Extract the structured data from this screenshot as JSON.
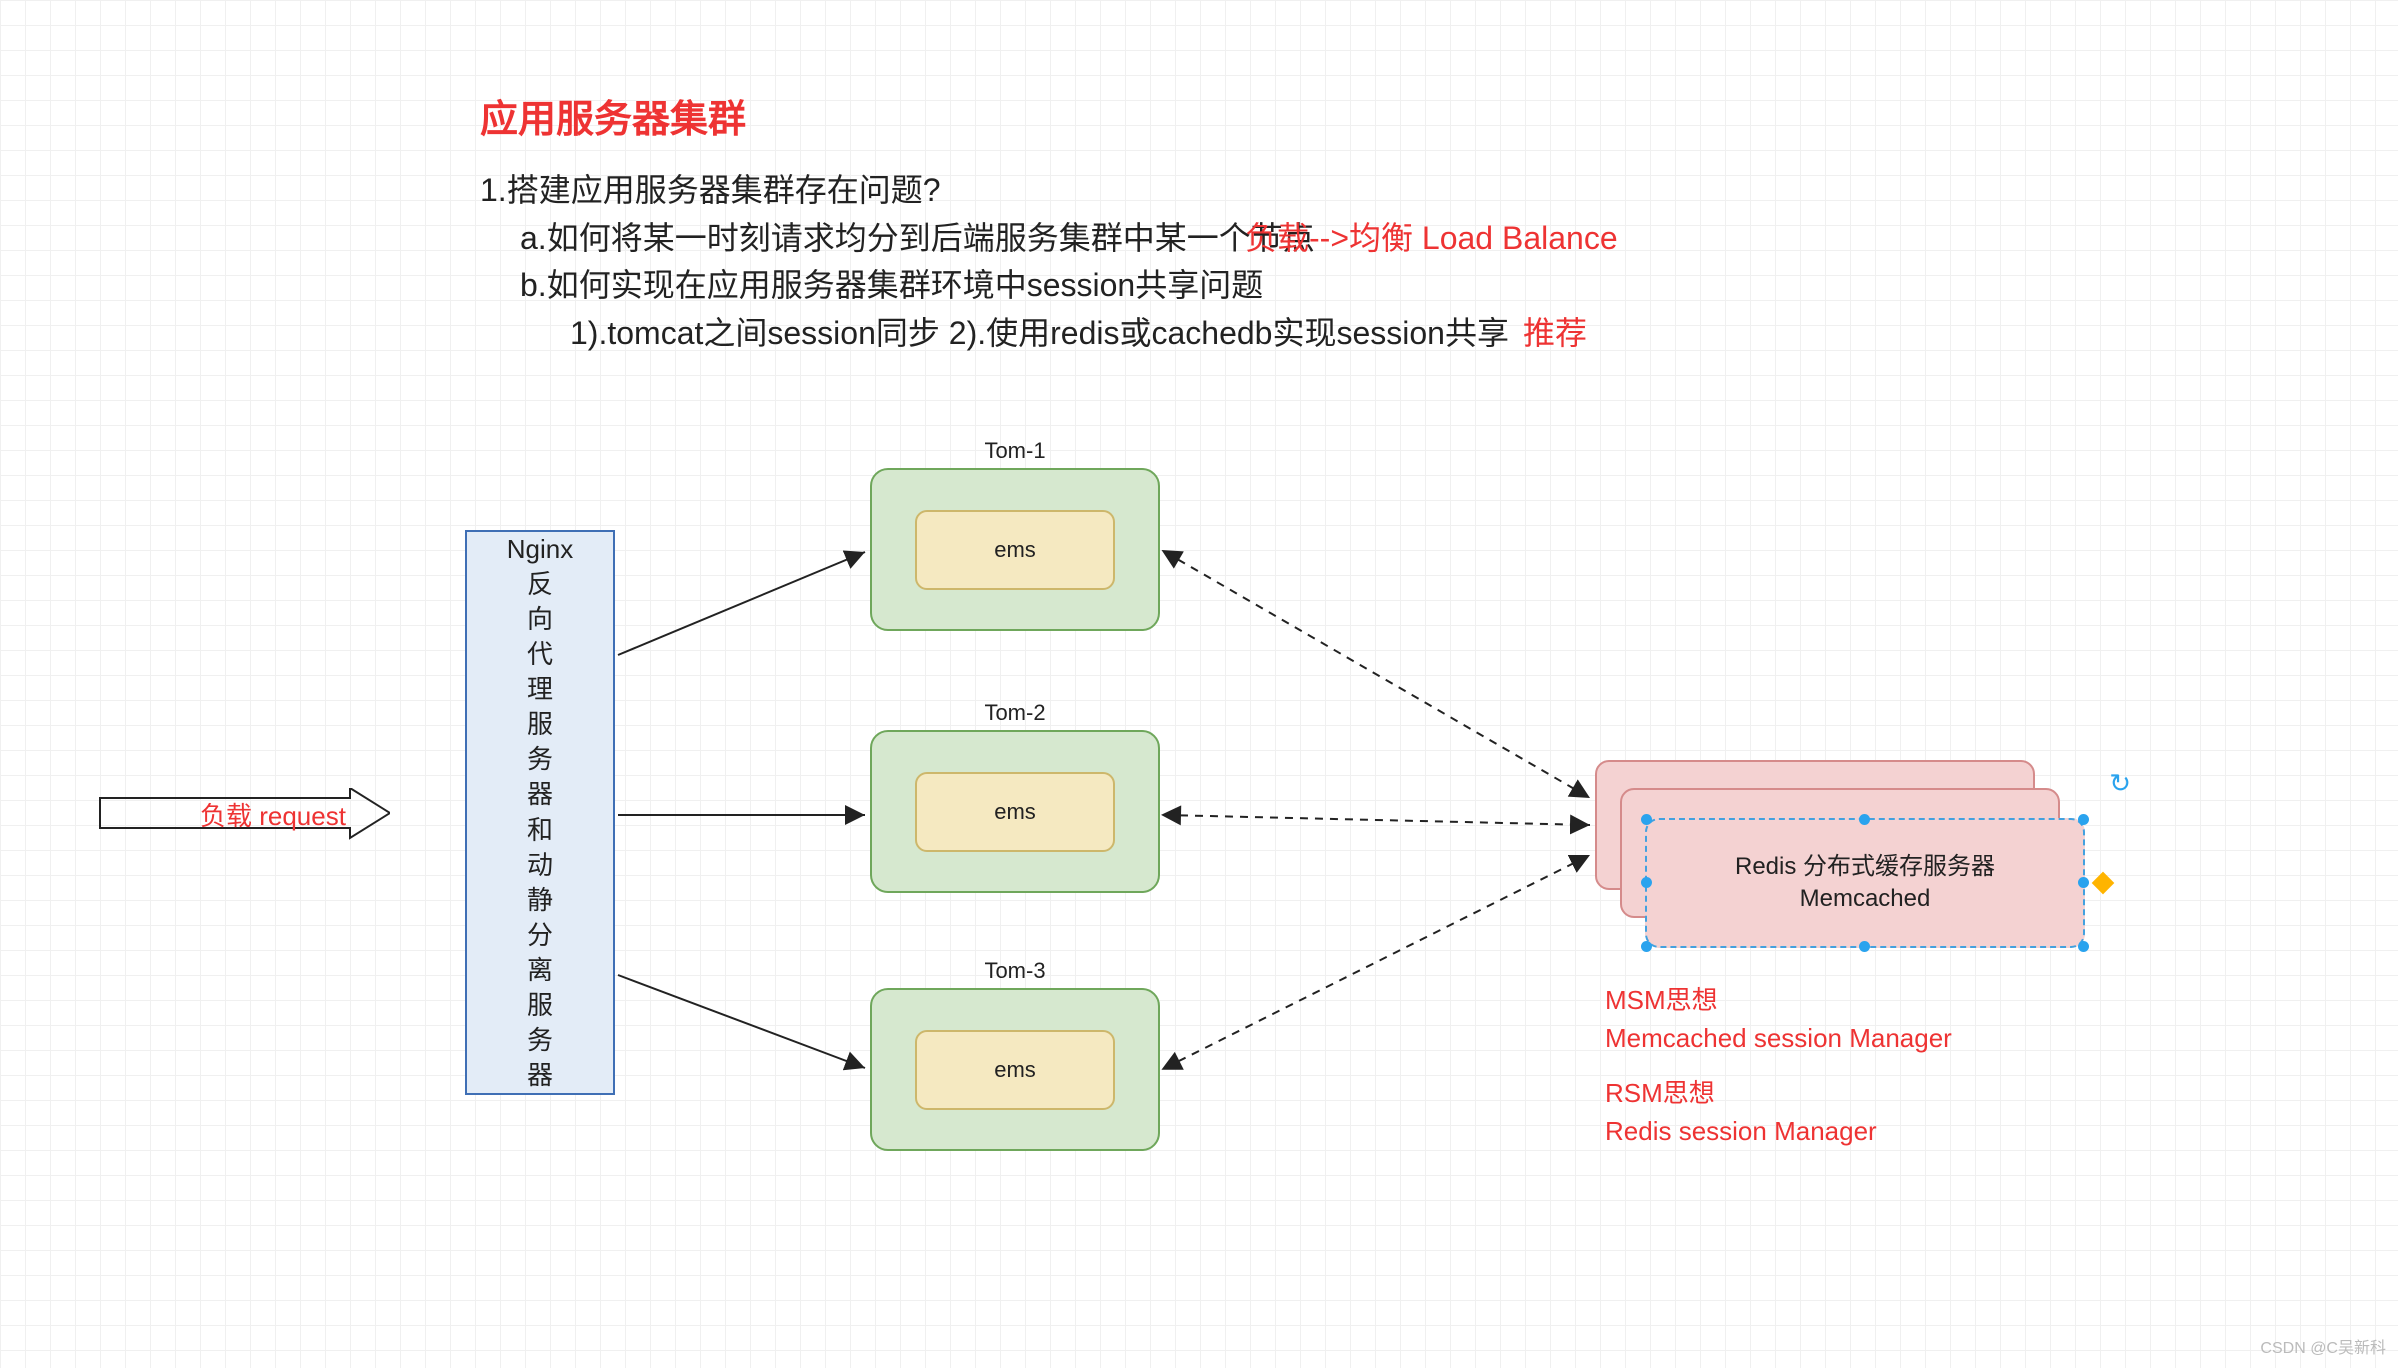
{
  "title": "应用服务器集群",
  "q1": "1.搭建应用服务器集群存在问题?",
  "qa": "a.如何将某一时刻请求均分到后端服务集群中某一个节点",
  "qa_red": "负载-->均衡  Load Balance",
  "qb": "b.如何实现在应用服务器集群环境中session共享问题",
  "qb1": "1).tomcat之间session同步 2).使用redis或cachedb实现session共享",
  "qb1_red": "推荐",
  "request_label": "负载 request",
  "nginx_text": "Nginx\n反\n向\n代\n理\n服\n务\n器\n和\n动\n静\n分\n离\n服\n务\n器",
  "tom": [
    "Tom-1",
    "Tom-2",
    "Tom-3"
  ],
  "ems": "ems",
  "redis_l1": "Redis 分布式缓存服务器",
  "redis_l2": "Memcached",
  "notes_1": "MSM思想",
  "notes_2": " Memcached session Manager",
  "notes_3": "RSM思想",
  "notes_4": " Redis  session Manager",
  "watermark": "CSDN @C吴新科"
}
